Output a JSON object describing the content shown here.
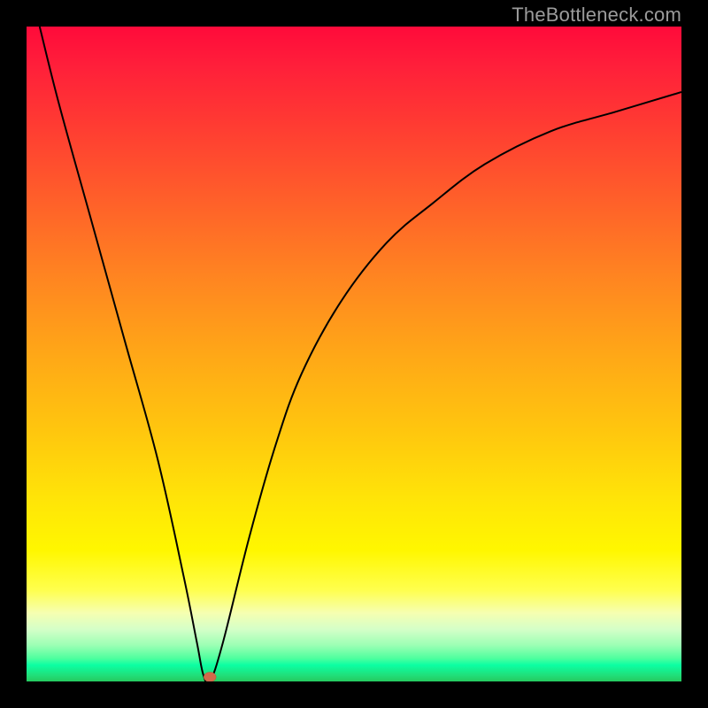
{
  "watermark": "TheBottleneck.com",
  "chart_data": {
    "type": "line",
    "title": "",
    "xlabel": "",
    "ylabel": "",
    "xlim": [
      0,
      100
    ],
    "ylim": [
      0,
      100
    ],
    "grid": false,
    "legend": false,
    "series": [
      {
        "name": "curve",
        "x": [
          2,
          5,
          10,
          15,
          20,
          24,
          26,
          27,
          28,
          30,
          34,
          38,
          42,
          48,
          55,
          62,
          70,
          80,
          90,
          100
        ],
        "y": [
          100,
          88,
          70,
          52,
          34,
          16,
          6,
          1,
          0,
          6,
          22,
          36,
          47,
          58,
          67,
          73,
          79,
          84,
          87,
          90
        ]
      }
    ],
    "marker": {
      "x": 28,
      "y": 0
    },
    "annotations": []
  },
  "colors": {
    "curve": "#000000",
    "marker": "#d2694a",
    "gradient_top": "#ff0a3a",
    "gradient_mid": "#ffd400",
    "gradient_bottom": "#25c95f",
    "frame": "#000000",
    "watermark": "#9b9b9b"
  }
}
